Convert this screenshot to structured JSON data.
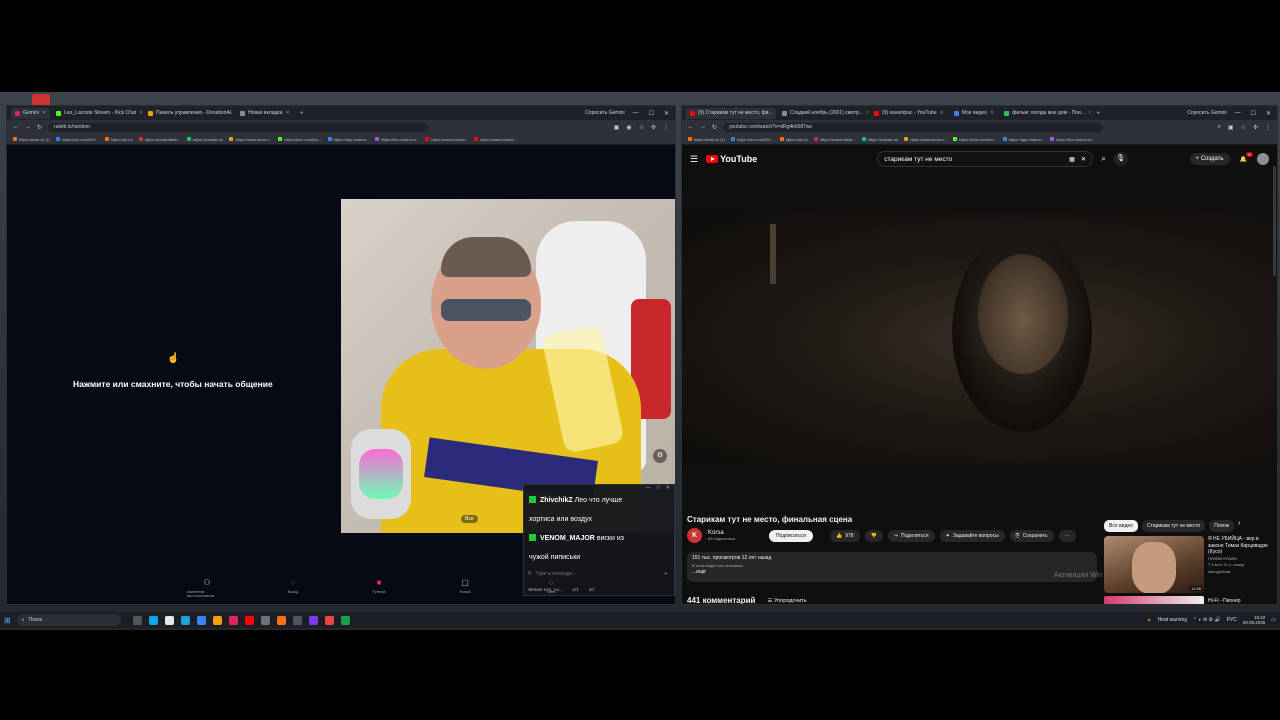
{
  "left_browser": {
    "tabs": [
      {
        "label": "Gemini",
        "color": "#e0245e",
        "active": true
      },
      {
        "label": "Leo_Lacoste Stream - Kick Chat",
        "color": "#53fc18"
      },
      {
        "label": "Панель управления - DonationAl.",
        "color": "#f59e0b"
      },
      {
        "label": "Новая вкладка",
        "color": "#8a8f96"
      }
    ],
    "gemini_label": "Спросить Gemini",
    "url": "ruletti.tv/random",
    "bookmarks": [
      "https://mail.ru/ (1)",
      "https://vk.com/id79...",
      "https://ok.ru/",
      "https://worldoftank...",
      "https://kontakt.ru/",
      "https://www.tema.c...",
      "https://kick.com/leo...",
      "https://app.restrea...",
      "https://the-radio.ru/r...",
      "https://www.youtub...",
      "https://www.youtub..."
    ]
  },
  "roulette": {
    "prompt": "Нажмите или смахните, чтобы начать общение",
    "webcam_tag": "Все",
    "nav": [
      {
        "label": "изменение местоположения",
        "icon": "people-icon"
      },
      {
        "label": "Выход",
        "icon": "chat-icon"
      },
      {
        "label": "Рулетка",
        "icon": "roulette-icon",
        "active": true
      },
      {
        "label": "Новый",
        "icon": "new-icon"
      },
      {
        "label": "Чаты",
        "icon": "chats-icon"
      }
    ]
  },
  "chat": {
    "messages": [
      {
        "user": "ZhivchikZ",
        "text": "Лео что лучше"
      },
      {
        "user": "",
        "text": "хортиса или воздух"
      },
      {
        "user": "VENOM_MAJOR",
        "text": "виски из"
      },
      {
        "user": "",
        "text": "чужой пиписьки"
      }
    ],
    "input_placeholder": "Type a message...",
    "footer_channel": "Stream Leo_La...",
    "footer_count": "1/1",
    "footer_viewers": "10"
  },
  "right_browser": {
    "tabs": [
      {
        "label": "(9) Старикам тут не место, фи...",
        "color": "#ff0000",
        "active": true
      },
      {
        "label": "Сладкий ноябрь (2001) смотр...",
        "color": "#8a8f96"
      },
      {
        "label": "(9) канал/рас - YouTube",
        "color": "#ff0000"
      },
      {
        "label": "Мое видео",
        "color": "#3b82f6"
      },
      {
        "label": "фильм: погода мне дом - Пои...",
        "color": "#22c55e"
      }
    ],
    "gemini_label": "Спросить Gemini",
    "url": "youtube.com/watch?v=dRg4kh587ws",
    "bookmarks": [
      "https://mail.ru/ (1)",
      "https://vk.com/id79...",
      "https://ok.ru/",
      "https://worldoftank...",
      "https://kontakt.ru/",
      "https://www.tema.c...",
      "https://kick.com/leo...",
      "https://app.restrea...",
      "https://the-radio.ru/r..."
    ]
  },
  "youtube": {
    "logo": "YouTube",
    "search_query": "старикам тут не место",
    "create_label": "Создать",
    "notifications": "9+",
    "video_title": "Старикам тут не место, финальная сцена",
    "channel_name": "Korsa",
    "channel_initial": "K",
    "channel_subs": "83 подписчика",
    "subscribe_label": "Подписаться",
    "likes": "978",
    "share_label": "Поделиться",
    "ask_label": "Задавайте вопросы",
    "save_label": "Сохранить",
    "desc_stats": "151 тыс. просмотров  12 лет назад",
    "desc_text": "В этом видео нет описания.",
    "desc_more": "...ещё",
    "comments_count": "441 комментарий",
    "sort_label": "Упорядочить",
    "chips": [
      {
        "label": "Все видео",
        "active": true
      },
      {
        "label": "Старикам тут не место"
      },
      {
        "label": "Похож"
      }
    ],
    "rec1": {
      "title": "Я НЕ УБИЙЦА - вор в законе Тамаз Карцивадзе (Кусо)",
      "channel": "ПРАЙМ КРАЙМ",
      "meta": "7,4 млн  13 л. назад",
      "duration": "12:55",
      "badge": "Автодубляж"
    },
    "rec2": {
      "title": "Hi-Fi - Пионер"
    },
    "activation": "Активация Win"
  },
  "taskbar": {
    "search_placeholder": "Поиск",
    "weather": "Heat warning",
    "lang": "РУС",
    "time": "16:22",
    "date": "09.08.2025"
  }
}
